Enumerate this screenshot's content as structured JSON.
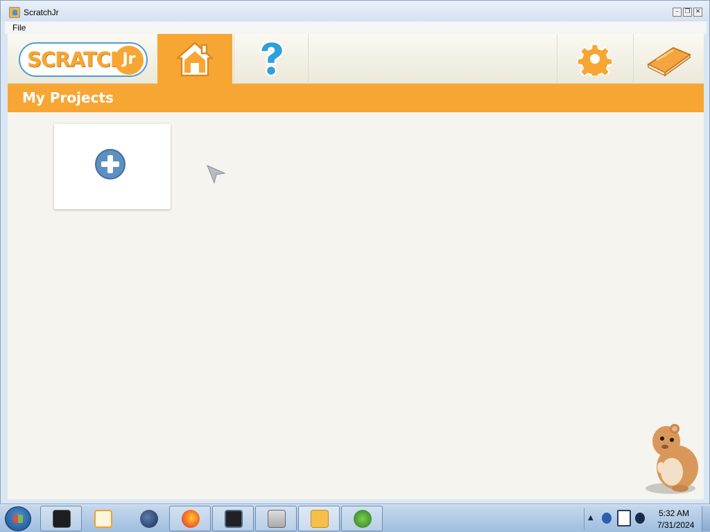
{
  "window": {
    "title": "ScratchJr",
    "controls": [
      "minimize",
      "restore",
      "close"
    ]
  },
  "menubar": {
    "items": [
      "File"
    ]
  },
  "app": {
    "logo_text": "SCRATCH",
    "logo_suffix": "Jr",
    "nav": {
      "active_tab": "home",
      "tabs": [
        {
          "name": "home",
          "icon": "home-icon"
        },
        {
          "name": "help",
          "icon": "question-icon"
        },
        {
          "name": "settings",
          "icon": "gear-icon"
        },
        {
          "name": "library",
          "icon": "book-icon"
        }
      ]
    },
    "heading": "My Projects",
    "projects": {
      "new_project_icon": "plus-circle-icon"
    },
    "colors": {
      "accent": "#f7a634",
      "plus_button": "#5d8fc2",
      "help": "#2ea0db"
    }
  },
  "taskbar": {
    "start_icon": "windows-start-icon",
    "items": [
      {
        "icon": "terminal-icon"
      },
      {
        "icon": "media-player-icon"
      },
      {
        "icon": "globe-icon"
      },
      {
        "icon": "firefox-icon"
      },
      {
        "icon": "window-app-icon"
      },
      {
        "icon": "control-panel-icon"
      },
      {
        "icon": "scratchjr-icon"
      },
      {
        "icon": "network-icon"
      }
    ],
    "tray": {
      "clock_time": "5:32 AM",
      "clock_date": "7/31/2024"
    }
  }
}
